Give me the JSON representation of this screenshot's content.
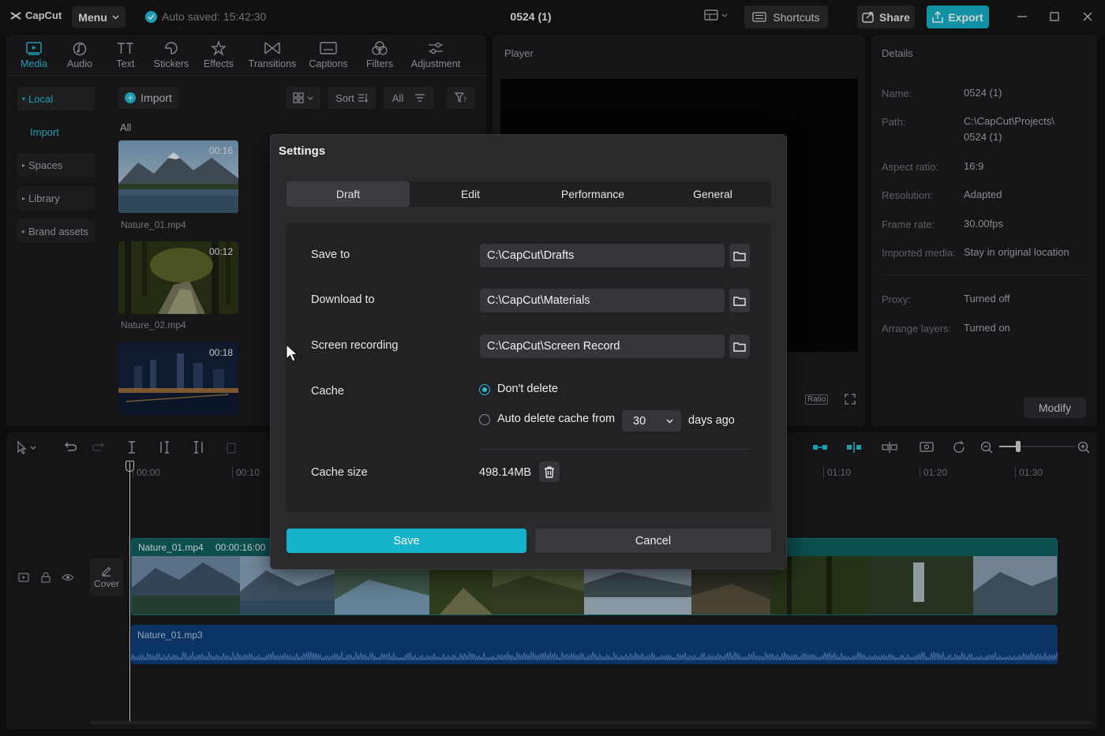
{
  "app": {
    "name": "CapCut",
    "menu_label": "Menu",
    "autosave": "Auto saved: 15:42:30",
    "project_title": "0524 (1)"
  },
  "header": {
    "shortcuts_label": "Shortcuts",
    "share_label": "Share",
    "export_label": "Export"
  },
  "toolbar": {
    "items": [
      {
        "label": "Media",
        "icon": "media-icon"
      },
      {
        "label": "Audio",
        "icon": "audio-icon"
      },
      {
        "label": "Text",
        "icon": "text-icon"
      },
      {
        "label": "Stickers",
        "icon": "stickers-icon"
      },
      {
        "label": "Effects",
        "icon": "effects-icon"
      },
      {
        "label": "Transitions",
        "icon": "transitions-icon"
      },
      {
        "label": "Captions",
        "icon": "captions-icon"
      },
      {
        "label": "Filters",
        "icon": "filters-icon"
      },
      {
        "label": "Adjustment",
        "icon": "adjustment-icon"
      }
    ]
  },
  "sidebar": {
    "items": [
      {
        "label": "Local"
      },
      {
        "label": "Import"
      },
      {
        "label": "Spaces"
      },
      {
        "label": "Library"
      },
      {
        "label": "Brand assets"
      }
    ]
  },
  "media": {
    "import_label": "Import",
    "sort_label": "Sort",
    "all_filter_label": "All",
    "all_section_label": "All",
    "clips": [
      {
        "name": "Nature_01.mp4",
        "duration": "00:16"
      },
      {
        "name": "Nature_02.mp4",
        "duration": "00:12"
      },
      {
        "name": "",
        "duration": "00:18"
      }
    ]
  },
  "player": {
    "title": "Player",
    "ratio_label": "Ratio"
  },
  "details": {
    "title": "Details",
    "rows": [
      {
        "key": "Name:",
        "value": "0524 (1)"
      },
      {
        "key": "Path:",
        "value": "C:\\CapCut\\Projects\\",
        "value2": "0524 (1)"
      },
      {
        "key": "Aspect ratio:",
        "value": "16:9"
      },
      {
        "key": "Resolution:",
        "value": "Adapted"
      },
      {
        "key": "Frame rate:",
        "value": "30.00fps"
      },
      {
        "key": "Imported media:",
        "value": "Stay in original location"
      },
      {
        "key": "Proxy:",
        "value": "Turned off"
      },
      {
        "key": "Arrange layers:",
        "value": "Turned on"
      }
    ],
    "modify_label": "Modify"
  },
  "timeline": {
    "ruler": [
      "00:00",
      "00:10",
      "01:10",
      "01:20",
      "01:30"
    ],
    "video_clip": {
      "name": "Nature_01.mp4",
      "duration": "00:00:16:00"
    },
    "audio_clip": {
      "name": "Nature_01.mp3"
    },
    "cover_label": "Cover",
    "zoom_level": 0.25
  },
  "settings": {
    "title": "Settings",
    "tabs": [
      "Draft",
      "Edit",
      "Performance",
      "General"
    ],
    "active_tab": "Draft",
    "save_to_label": "Save to",
    "save_to_value": "C:\\CapCut\\Drafts",
    "download_to_label": "Download to",
    "download_to_value": "C:\\CapCut\\Materials",
    "screen_recording_label": "Screen recording",
    "screen_recording_value": "C:\\CapCut\\Screen Record",
    "cache_label": "Cache",
    "cache_option_keep": "Don't delete",
    "cache_option_auto": "Auto delete cache from",
    "cache_days_value": "30",
    "cache_days_suffix": "days ago",
    "cache_size_label": "Cache size",
    "cache_size_value": "498.14MB",
    "save_label": "Save",
    "cancel_label": "Cancel"
  },
  "colors": {
    "accent": "#21c1d6",
    "export_bg": "#15b3c9",
    "video_track": "#0f5e60",
    "audio_track": "#0e3f7a"
  }
}
